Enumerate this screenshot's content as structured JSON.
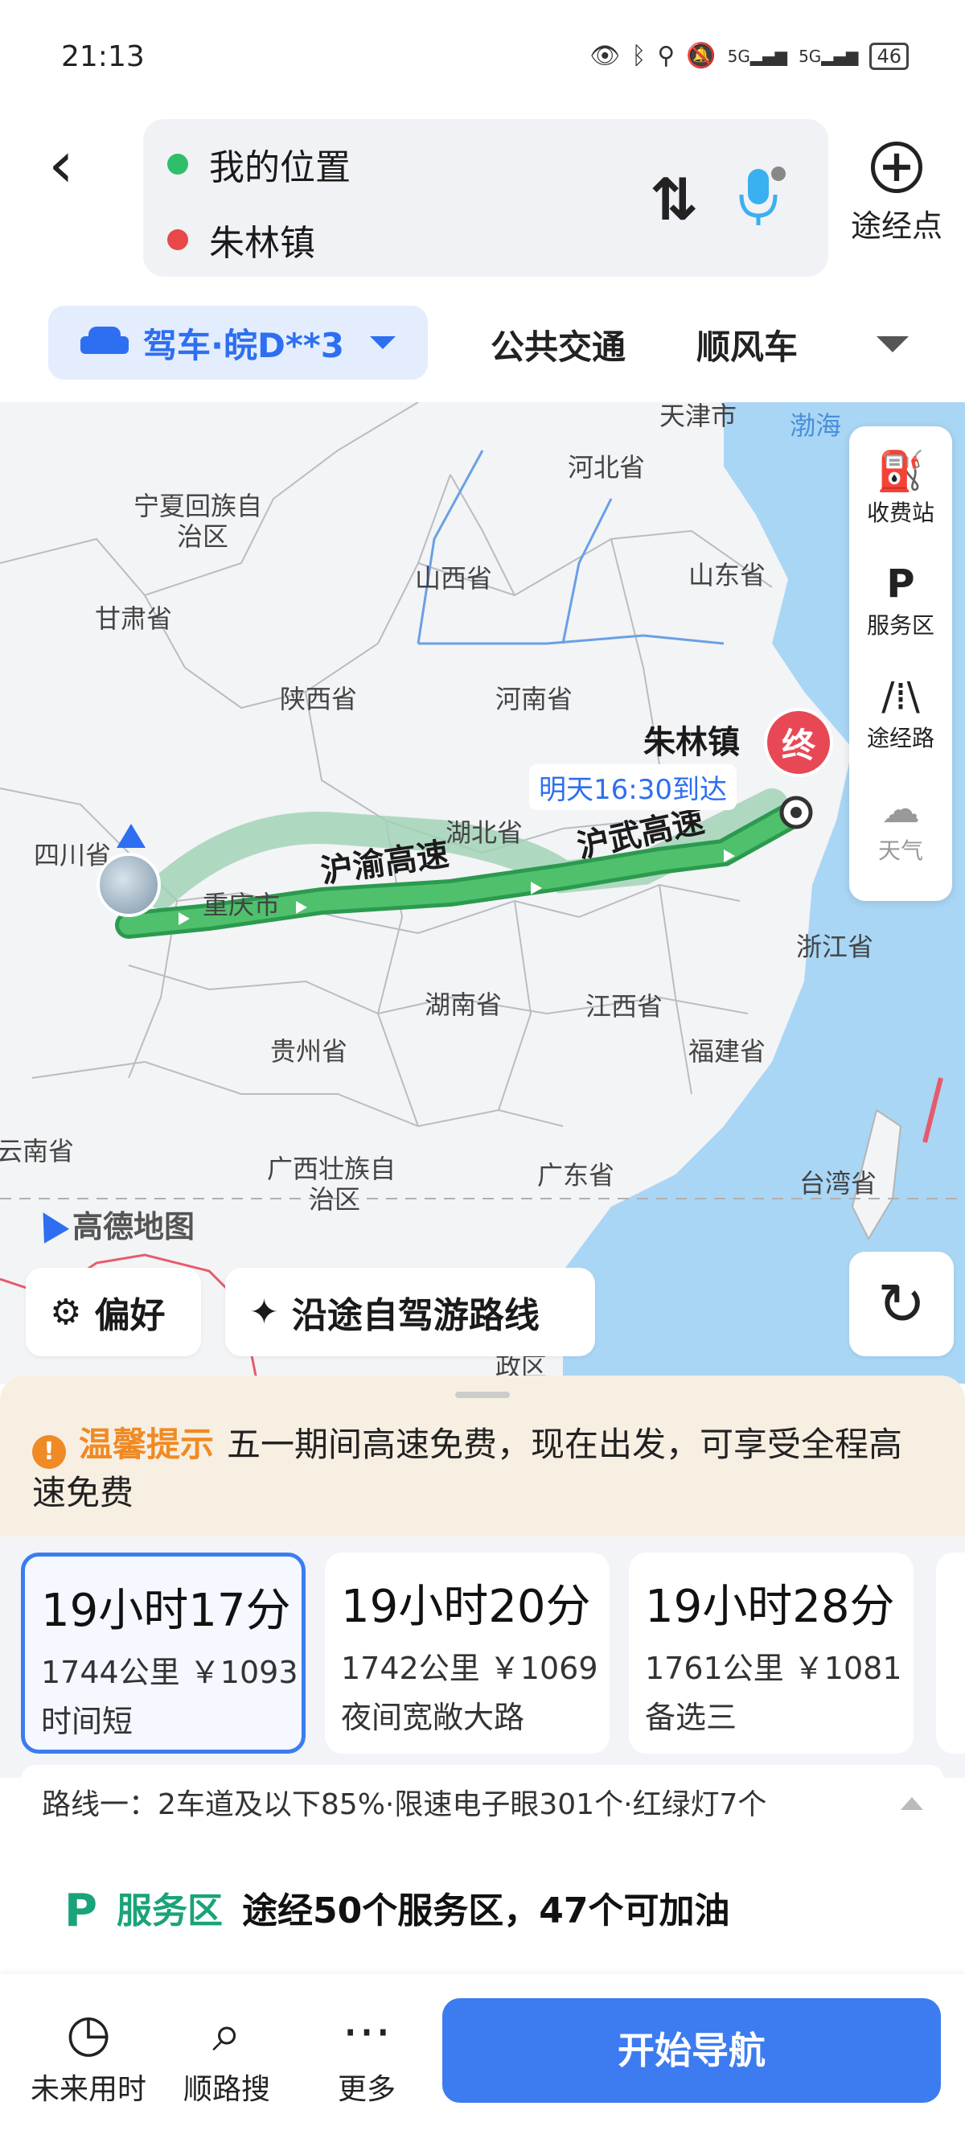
{
  "status_bar": {
    "time": "21:13",
    "battery": "46",
    "signal_1": "5G",
    "signal_2": "5G"
  },
  "header": {
    "start_label": "我的位置",
    "end_label": "朱林镇",
    "waypoint_label": "途经点",
    "start_dot_color": "#2fbf6b",
    "end_dot_color": "#e84848"
  },
  "modes": {
    "drive": "驾车·皖D**3",
    "transit": "公共交通",
    "carpool": "顺风车"
  },
  "map": {
    "labels": [
      {
        "text": "天津市"
      },
      {
        "text": "渤海"
      },
      {
        "text": "河北省"
      },
      {
        "text": "宁夏回族自"
      },
      {
        "text": "治区"
      },
      {
        "text": "山西省"
      },
      {
        "text": "山东省"
      },
      {
        "text": "甘肃省"
      },
      {
        "text": "陕西省"
      },
      {
        "text": "河南省"
      },
      {
        "text": "四川省"
      },
      {
        "text": "湖北省"
      },
      {
        "text": "重庆市"
      },
      {
        "text": "浙江省"
      },
      {
        "text": "湖南省"
      },
      {
        "text": "江西省"
      },
      {
        "text": "贵州省"
      },
      {
        "text": "福建省"
      },
      {
        "text": "云南省"
      },
      {
        "text": "广西壮族自"
      },
      {
        "text": "治区"
      },
      {
        "text": "广东省"
      },
      {
        "text": "台湾省"
      },
      {
        "text": "政区"
      }
    ],
    "route_names": [
      "沪渝高速",
      "沪武高速"
    ],
    "destination": "朱林镇",
    "end_marker": "终",
    "eta": "明天16:30到达",
    "logo": "高德地图",
    "tools": [
      {
        "icon": "toll-station-icon",
        "label": "收费站"
      },
      {
        "icon": "service-area-icon",
        "label": "服务区"
      },
      {
        "icon": "route-road-icon",
        "label": "途经路"
      },
      {
        "icon": "weather-icon",
        "label": "天气"
      }
    ],
    "chip_pref": "偏好",
    "chip_trip": "沿途自驾游路线"
  },
  "notice": {
    "tag": "温馨提示",
    "text": "五一期间高速免费，现在出发，可享受全程高速免费"
  },
  "routes": [
    {
      "duration": "19小时17分",
      "meta": "1744公里 ￥1093",
      "kind": "时间短",
      "selected": true
    },
    {
      "duration": "19小时20分",
      "meta": "1742公里 ￥1069",
      "kind": "夜间宽敞大路",
      "selected": false
    },
    {
      "duration": "19小时28分",
      "meta": "1761公里 ￥1081",
      "kind": "备选三",
      "selected": false
    }
  ],
  "route_detail": "路线一：2车道及以下85%·限速电子眼301个·红绿灯7个",
  "service": {
    "tag": "服务区",
    "text": "途经50个服务区，47个可加油"
  },
  "bottom": {
    "future_time": "未来用时",
    "along_search": "顺路搜",
    "more": "更多",
    "start_nav": "开始导航"
  }
}
